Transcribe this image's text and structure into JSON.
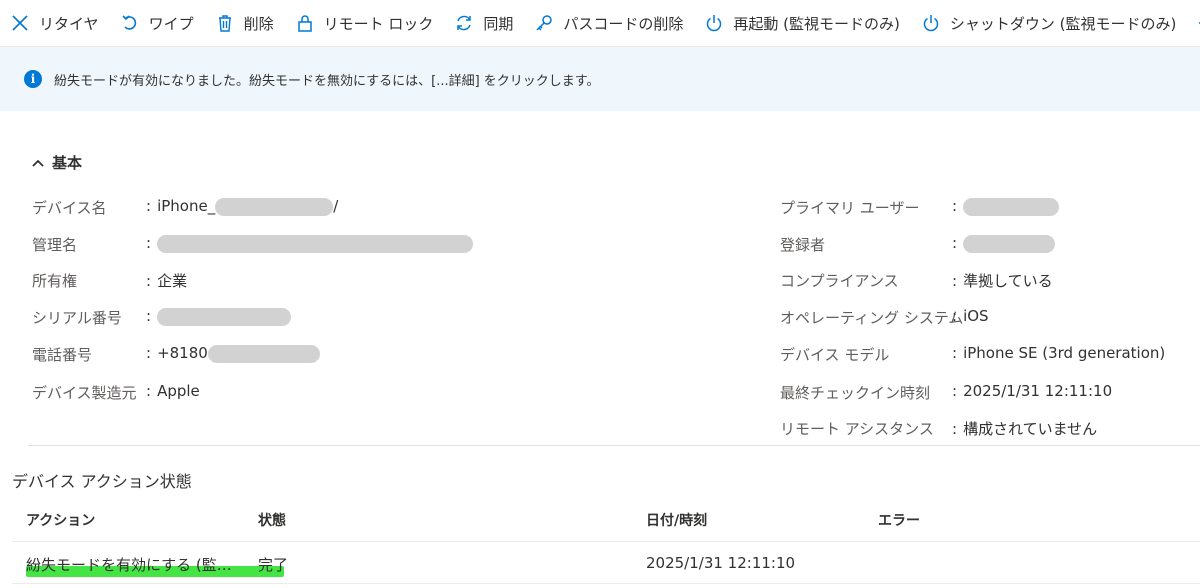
{
  "toolbar": {
    "items": [
      {
        "label": "リタイヤ",
        "icon": "close-icon"
      },
      {
        "label": "ワイプ",
        "icon": "undo-icon"
      },
      {
        "label": "削除",
        "icon": "trash-icon"
      },
      {
        "label": "リモート ロック",
        "icon": "lock-icon"
      },
      {
        "label": "同期",
        "icon": "sync-icon"
      },
      {
        "label": "パスコードの削除",
        "icon": "key-icon"
      },
      {
        "label": "再起動 (監視モードのみ)",
        "icon": "power-icon"
      },
      {
        "label": "シャットダウン (監視モードのみ)",
        "icon": "power-icon"
      }
    ],
    "more_icon": "arrow-right-icon"
  },
  "banner": {
    "icon": "info-icon",
    "text": "紛失モードが有効になりました。紛失モードを無効にするには、[...詳細] をクリックします。"
  },
  "essentials": {
    "title": "基本",
    "left": [
      {
        "label": "デバイス名",
        "value": "iPhone_",
        "suffix": "/"
      },
      {
        "label": "管理名",
        "value": ""
      },
      {
        "label": "所有権",
        "value": "企業"
      },
      {
        "label": "シリアル番号",
        "value": ""
      },
      {
        "label": "電話番号",
        "value": "+8180"
      },
      {
        "label": "デバイス製造元",
        "value": "Apple"
      }
    ],
    "right": [
      {
        "label": "プライマリ ユーザー",
        "value": ""
      },
      {
        "label": "登録者",
        "value": ""
      },
      {
        "label": "コンプライアンス",
        "value": "準拠している"
      },
      {
        "label": "オペレーティング システム",
        "value": "iOS"
      },
      {
        "label": "デバイス モデル",
        "value": "iPhone SE (3rd generation)"
      },
      {
        "label": "最終チェックイン時刻",
        "value": "2025/1/31 12:11:10"
      },
      {
        "label": "リモート アシスタンス",
        "value": "構成されていません"
      }
    ]
  },
  "actions": {
    "title": "デバイス アクション状態",
    "columns": [
      "アクション",
      "状態",
      "日付/時刻",
      "エラー"
    ],
    "rows": [
      {
        "action": "紛失モードを有効にする (監…",
        "status": "完了",
        "datetime": "2025/1/31 12:11:10",
        "error": ""
      }
    ]
  },
  "colors": {
    "accent": "#0078d4",
    "banner_bg": "#eff6fc",
    "highlight": "#39e33a"
  }
}
